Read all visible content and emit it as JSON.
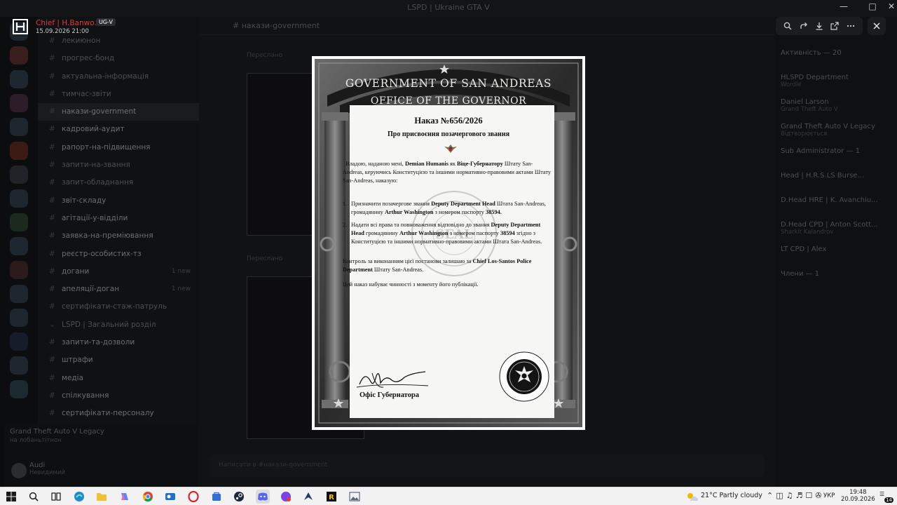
{
  "app": {
    "window_title": "LSPD | Ukraine GTA V"
  },
  "sidebar": {
    "channels": [
      {
        "label": "лекиюнон",
        "active": false
      },
      {
        "label": "прогрес-бонд",
        "active": false
      },
      {
        "label": "актуальна-інформація",
        "active": false
      },
      {
        "label": "тимчас-звіти",
        "active": false
      },
      {
        "label": "накази-government",
        "active": true
      },
      {
        "label": "кадровий-аудит",
        "active": false
      },
      {
        "label": "рапорт-на-підвищення",
        "active": false
      },
      {
        "label": "запити-на-звання",
        "active": false
      },
      {
        "label": "запит-обладнання",
        "active": false
      },
      {
        "label": "звіт-складу",
        "active": false
      },
      {
        "label": "агітації-у-відділи",
        "active": false
      },
      {
        "label": "заявка-на-преміювання",
        "active": false
      },
      {
        "label": "реєстр-особистих-тз",
        "active": false
      },
      {
        "label": "догани",
        "active": false,
        "count": "1 new"
      },
      {
        "label": "апеляції-доган",
        "active": false,
        "count": "1 new"
      },
      {
        "label": "сертифікати-стаж-патруль",
        "active": false
      },
      {
        "label": "LSPD | Загальний розділ",
        "active": false
      },
      {
        "label": "запити-та-дозволи",
        "active": false
      },
      {
        "label": "штрафи",
        "active": false
      },
      {
        "label": "медіа",
        "active": false
      },
      {
        "label": "спілкування",
        "active": false
      },
      {
        "label": "сертифікати-персоналу",
        "active": false
      }
    ],
    "game_activity": {
      "title": "Grand Theft Auto V Legacy",
      "subtitle": "на лобаньтітнон"
    },
    "user": {
      "name": "Audi",
      "status": "Невидимий"
    }
  },
  "chat": {
    "header": "накази-government",
    "meta_top": "Переслано",
    "meta_bottom": "Переслано",
    "input_placeholder": "Написати в #накази-government"
  },
  "members": [
    {
      "name": "Активність — 20",
      "sub": ""
    },
    {
      "name": "HLSPD Department",
      "sub": "Wordle"
    },
    {
      "name": "Daniel Larson",
      "sub": "Grand Theft Auto V"
    },
    {
      "name": "Grand Theft Auto V Legacy",
      "sub": "Відтворюється"
    },
    {
      "name": "Sub Administrator — 1",
      "sub": ""
    },
    {
      "name": "Head | H.R.S.LS Burse...",
      "sub": ""
    },
    {
      "name": "D.Head HRE | K. Avanchiu...",
      "sub": ""
    },
    {
      "name": "D.Head CPD | Anton Scott...",
      "sub": "Sharkit Kalandrov"
    },
    {
      "name": "LT CPD | Alex",
      "sub": ""
    },
    {
      "name": "Члени — 1",
      "sub": ""
    }
  ],
  "viewer": {
    "author": "Chief | H.Banwo...",
    "tag": "UG-V",
    "date": "15.09.2026 21:00"
  },
  "document": {
    "header_line1": "GOVERNMENT OF SAN ANDREAS",
    "header_line2": "OFFICE OF THE GOVERNOR",
    "number": "Наказ №656/2026",
    "subject": "Про присвоєння позачергового звання",
    "intro": {
      "t1": "Владою, наданою мені, ",
      "b1": "Demian Humanis",
      "t2": " як ",
      "b2": "Віце-Губернатору",
      "t3": " Штату San-Andreas, керуючись Конституцією та  іншими нормативно-правовими актами Штату San-Andreas, наказую:"
    },
    "item1": {
      "num": "1.",
      "t1": "Призначити позачергове звання ",
      "b1": "Deputy Department Head",
      "t2": " Штата San-Andreas, громадянину ",
      "b2": "Arthur Washington",
      "t3": " з номером паспорту ",
      "b3": "38594."
    },
    "item2": {
      "num": "2.",
      "t1": "Надати всі права та повноваження відповідно до звання ",
      "b1": "Deputy Department Head",
      "t2": " громадянину ",
      "b2": "Arthur Washington",
      "t3": " з номером паспорту ",
      "b3": "38594",
      "t4": " згідно з Конституцією та іншими нормативно-правовими актами Штата San-Andreas."
    },
    "control": {
      "t1": "Контроль за виконанням цієї постанови залишаю за ",
      "b1": "Chief Los-Santos Police Department",
      "t2": " Штату San-Andreas."
    },
    "effect": "Цей наказ набуває чинності з моменту його публікації.",
    "signoff": "Офіс Губернатора",
    "seal_text": "GOVERNOR'S OFFICE",
    "gov_seal_text": "THE GOVERNOR OF THE STATE OF SAN ANDREAS"
  },
  "taskbar": {
    "weather": "21°C  Partly cloudy",
    "language": "УКР",
    "time": "19:48",
    "date": "20.09.2026",
    "notifications": "14"
  }
}
